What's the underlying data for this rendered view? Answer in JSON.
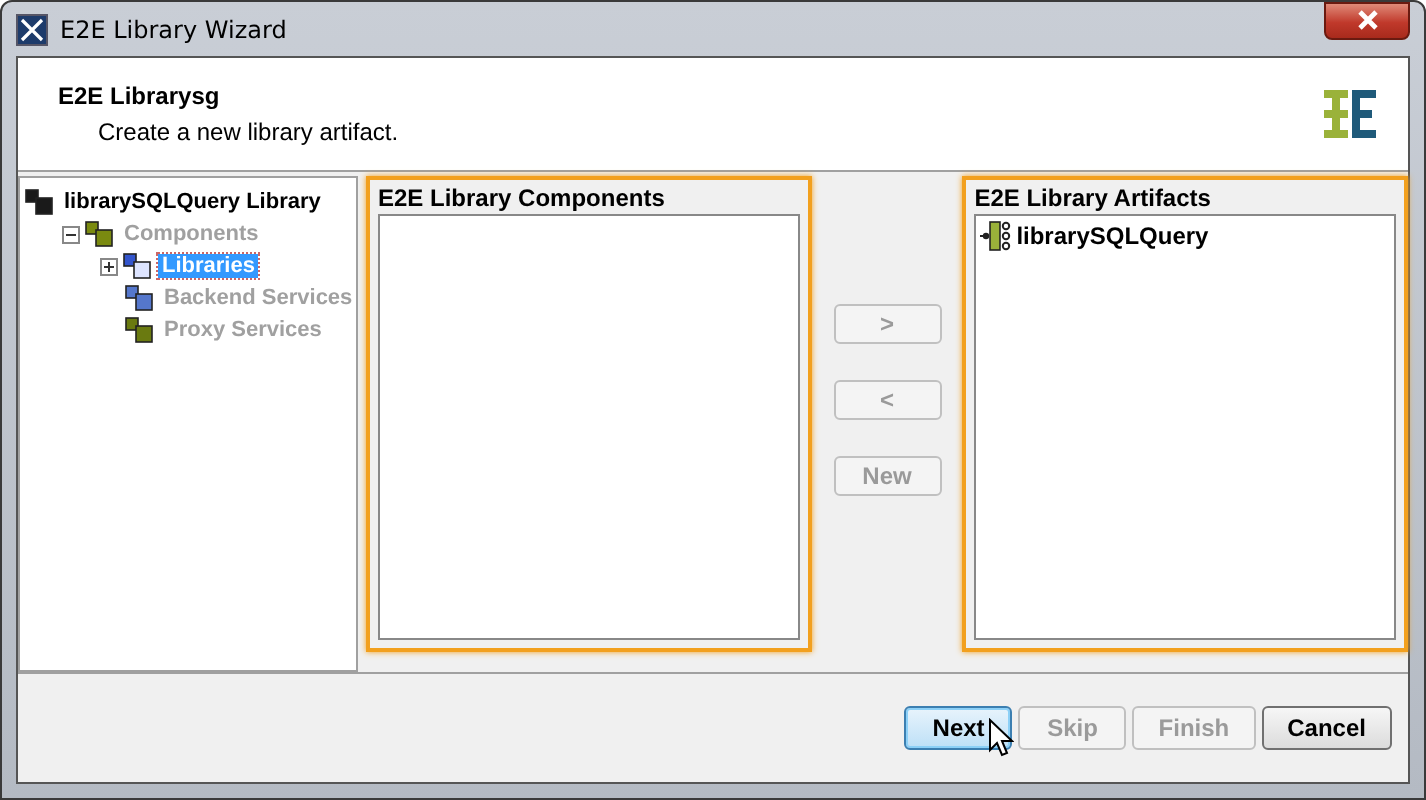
{
  "window": {
    "title": "E2E Library Wizard"
  },
  "header": {
    "title": "E2E Librarysg",
    "subtitle": "Create a new library artifact."
  },
  "tree": {
    "items": [
      {
        "label": "librarySQLQuery Library",
        "kind": "library",
        "disabled": false,
        "selected": false,
        "children": [
          {
            "label": "Components",
            "kind": "components",
            "disabled": true,
            "selected": false,
            "expanded": true,
            "children": [
              {
                "label": "Libraries",
                "kind": "libraries",
                "disabled": false,
                "selected": true,
                "expanded": false
              },
              {
                "label": "Backend Services",
                "kind": "backend",
                "disabled": true,
                "selected": false
              },
              {
                "label": "Proxy Services",
                "kind": "proxy",
                "disabled": true,
                "selected": false
              }
            ]
          }
        ]
      }
    ]
  },
  "components_panel": {
    "title": "E2E Library Components"
  },
  "transfer_buttons": [
    {
      "label": ">",
      "disabled": true
    },
    {
      "label": "<",
      "disabled": true
    },
    {
      "label": "New",
      "disabled": true
    }
  ],
  "artifacts_panel": {
    "title": "E2E Library Artifacts",
    "items": [
      {
        "label": "librarySQLQuery"
      }
    ]
  },
  "footer_buttons": [
    {
      "label": "Next",
      "disabled": false,
      "default": true
    },
    {
      "label": "Skip",
      "disabled": true,
      "default": false
    },
    {
      "label": "Finish",
      "disabled": true,
      "default": false
    },
    {
      "label": "Cancel",
      "disabled": false,
      "default": false
    }
  ]
}
